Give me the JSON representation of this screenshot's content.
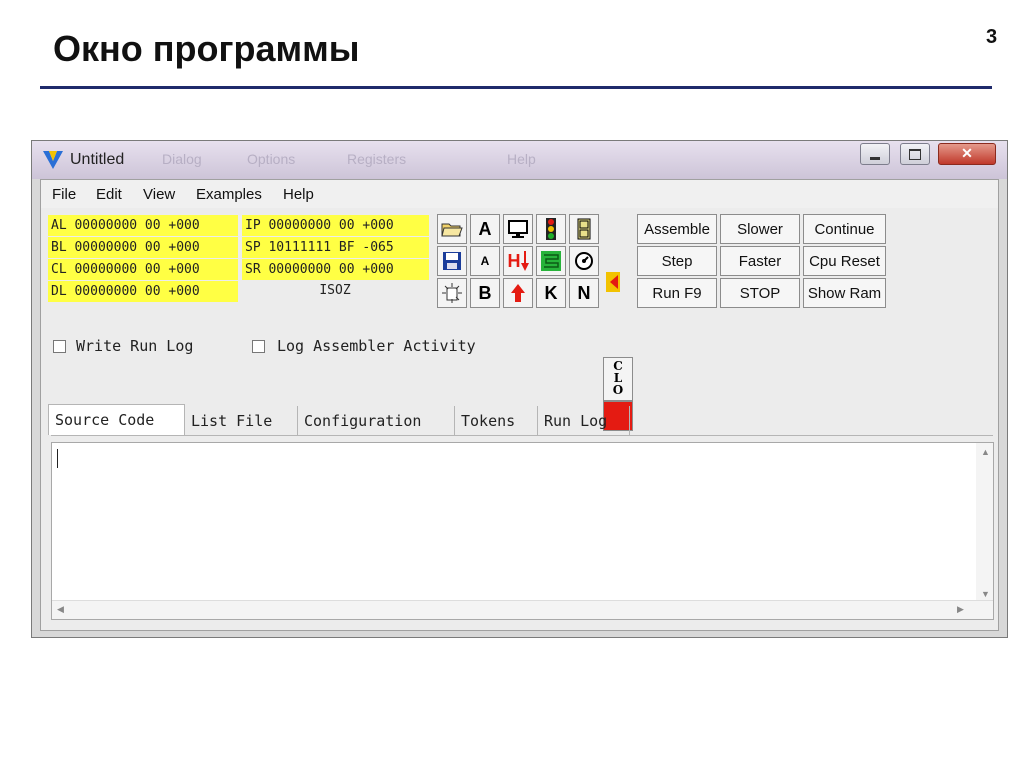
{
  "slide": {
    "title": "Окно программы",
    "page_number": "3"
  },
  "window": {
    "title": "Untitled",
    "faded_titles": [
      "Dialog",
      "Options",
      "Registers",
      "Help"
    ],
    "controls": {
      "minimize": "minimize",
      "maximize": "maximize",
      "close": "close"
    }
  },
  "menu": [
    "File",
    "Edit",
    "View",
    "Examples",
    "Help"
  ],
  "registers": {
    "left": [
      "AL 00000000 00 +000",
      "BL 00000000 00 +000",
      "CL 00000000 00 +000",
      "DL 00000000 00 +000"
    ],
    "right": [
      "IP 00000000 00 +000",
      "SP 10111111 BF -065",
      "SR 00000000 00 +000"
    ],
    "flags": "ISOZ"
  },
  "toolbar": {
    "letters": {
      "a_big": "A",
      "a_small": "A",
      "hi": "H",
      "b": "B",
      "k": "K",
      "n": "N"
    },
    "clo": [
      "C",
      "L",
      "O"
    ]
  },
  "actions": {
    "assemble": "Assemble",
    "slower": "Slower",
    "continue": "Continue",
    "step": "Step",
    "faster": "Faster",
    "cpu_reset": "Cpu Reset",
    "run": "Run F9",
    "stop": "STOP",
    "show_ram": "Show Ram"
  },
  "options": {
    "write_run_log": "Write Run Log",
    "log_assembler": "Log Assembler Activity"
  },
  "tabs": [
    "Source Code",
    "List File",
    "Configuration",
    "Tokens",
    "Run Log"
  ],
  "colors": {
    "register_bg": "#ffff44",
    "title_rule": "#1f2a6b",
    "close_btn": "#c0392b",
    "red_button": "#e41b12"
  }
}
